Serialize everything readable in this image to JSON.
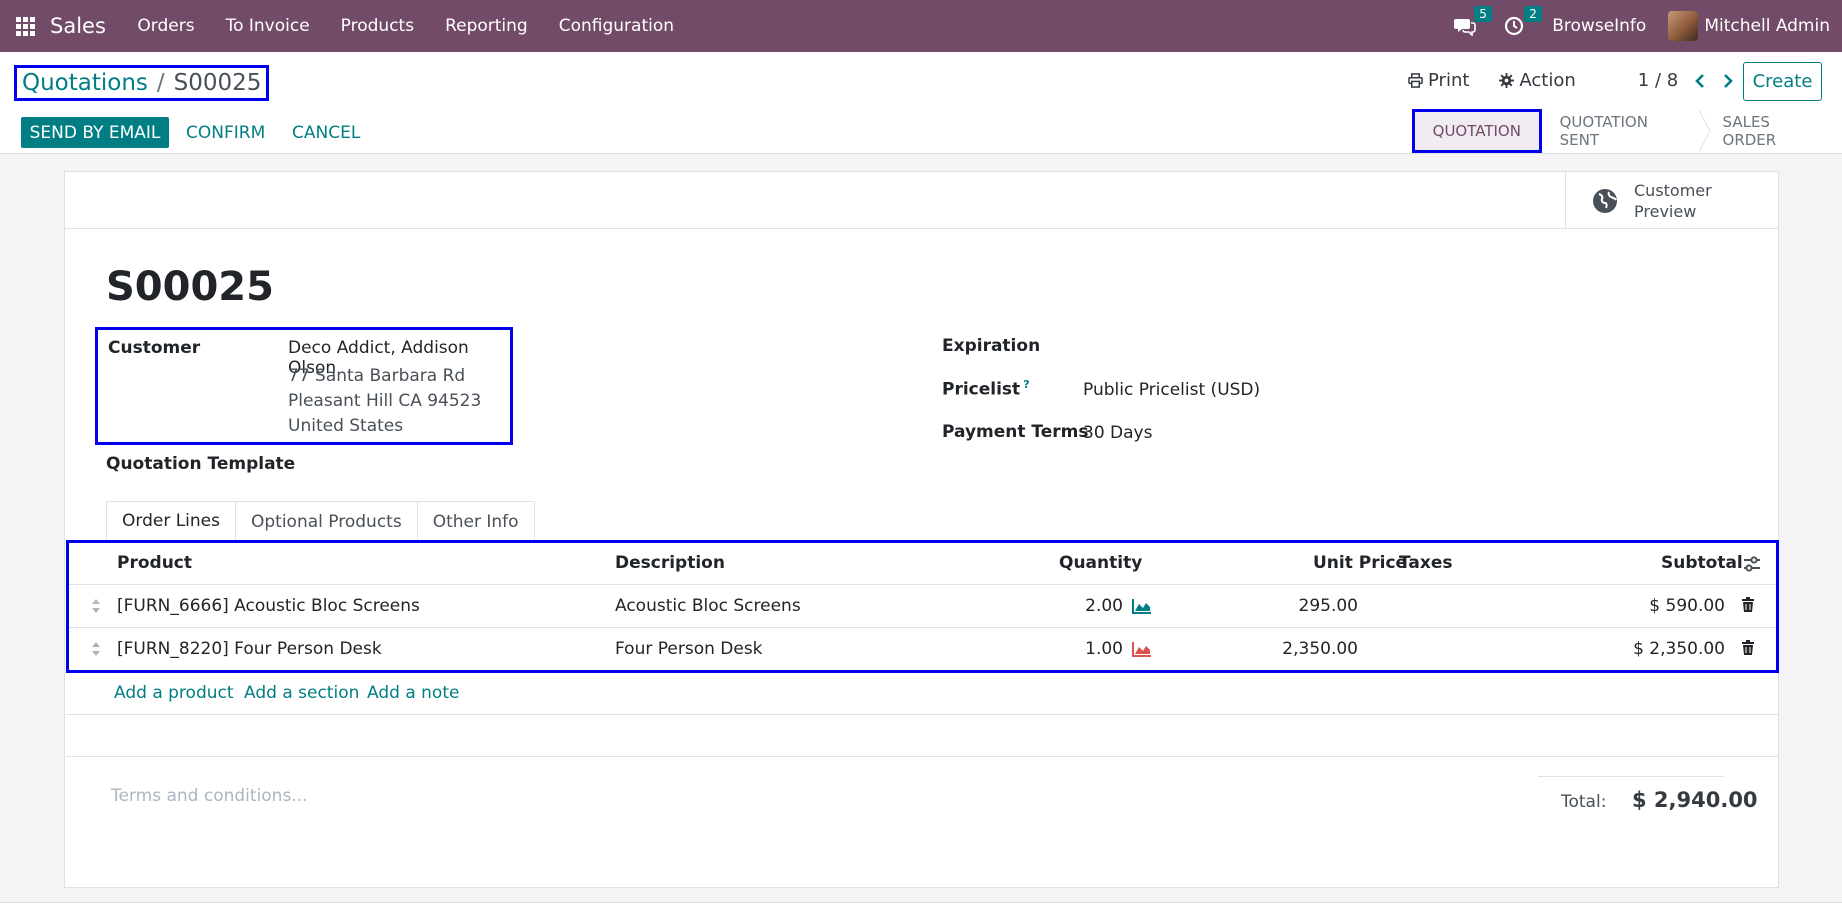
{
  "navbar": {
    "app_name": "Sales",
    "menu": [
      "Orders",
      "To Invoice",
      "Products",
      "Reporting",
      "Configuration"
    ],
    "messages_count": "5",
    "activities_count": "2",
    "company": "BrowseInfo",
    "user": "Mitchell Admin"
  },
  "breadcrumb": {
    "parent": "Quotations",
    "separator": "/",
    "current": "S00025"
  },
  "toolbar": {
    "print": "Print",
    "action": "Action",
    "pager": "1 / 8",
    "create": "Create"
  },
  "actions": {
    "send_email": "SEND BY EMAIL",
    "confirm": "CONFIRM",
    "cancel": "CANCEL"
  },
  "statusbar": {
    "stages": [
      "QUOTATION",
      "QUOTATION SENT",
      "SALES ORDER"
    ],
    "active": "QUOTATION"
  },
  "form": {
    "preview_button": "Customer Preview",
    "name": "S00025",
    "customer_label": "Customer",
    "customer_name": "Deco Addict, Addison Olson",
    "customer_address": [
      "77 Santa Barbara Rd",
      "Pleasant Hill CA 94523",
      "United States"
    ],
    "template_label": "Quotation Template",
    "expiration_label": "Expiration",
    "pricelist_label": "Pricelist",
    "pricelist_help": "?",
    "pricelist_value": "Public Pricelist (USD)",
    "payment_terms_label": "Payment Terms",
    "payment_terms_value": "30 Days"
  },
  "tabs": [
    "Order Lines",
    "Optional Products",
    "Other Info"
  ],
  "order_lines": {
    "columns": [
      "Product",
      "Description",
      "Quantity",
      "Unit Price",
      "Taxes",
      "Subtotal"
    ],
    "rows": [
      {
        "product": "[FURN_6666] Acoustic Bloc Screens",
        "description": "Acoustic Bloc Screens",
        "quantity": "2.00",
        "unit_price": "295.00",
        "taxes": "",
        "subtotal": "$ 590.00",
        "forecast_color": "#017e84"
      },
      {
        "product": "[FURN_8220] Four Person Desk",
        "description": "Four Person Desk",
        "quantity": "1.00",
        "unit_price": "2,350.00",
        "taxes": "",
        "subtotal": "$ 2,350.00",
        "forecast_color": "#d9534f"
      }
    ],
    "add_links": [
      "Add a product",
      "Add a section",
      "Add a note"
    ]
  },
  "footer": {
    "terms_placeholder": "Terms and conditions...",
    "total_label": "Total:",
    "total_value": "$ 2,940.00"
  },
  "colors": {
    "brand": "#714b67",
    "accent": "#017e84",
    "highlight_box": "#0000ee"
  }
}
